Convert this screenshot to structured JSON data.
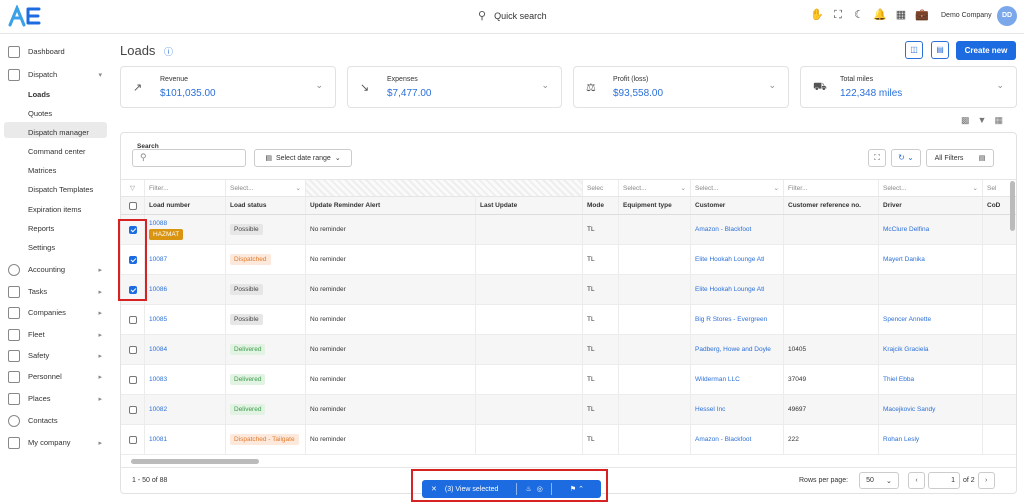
{
  "topbar": {
    "quick_search": "Quick search",
    "company": "Demo Company",
    "avatar": "DD"
  },
  "sidebar": {
    "dashboard": "Dashboard",
    "dispatch": "Dispatch",
    "dispatch_items": [
      "Loads",
      "Quotes",
      "Dispatch manager",
      "Command center",
      "Matrices",
      "Dispatch Templates",
      "Expiration items",
      "Reports",
      "Settings"
    ],
    "sections": [
      "Accounting",
      "Tasks",
      "Companies",
      "Fleet",
      "Safety",
      "Personnel",
      "Places",
      "Contacts",
      "My company"
    ]
  },
  "page": {
    "title": "Loads",
    "create_button": "Create new"
  },
  "cards": [
    {
      "label": "Revenue",
      "value": "$101,035.00"
    },
    {
      "label": "Expenses",
      "value": "$7,477.00"
    },
    {
      "label": "Profit (loss)",
      "value": "$93,558.00"
    },
    {
      "label": "Total miles",
      "value": "122,348 miles"
    }
  ],
  "toolbar": {
    "search_label": "Search",
    "date_range": "Select date range",
    "all_filters": "All Filters"
  },
  "filters": {
    "filter": "Filter...",
    "select": "Select...",
    "select_short": "Selec",
    "sel_short": "Sel"
  },
  "columns": [
    "Load number",
    "Load status",
    "Update Reminder Alert",
    "Last Update",
    "Mode",
    "Equipment type",
    "Customer",
    "Customer reference no.",
    "Driver",
    "CoD"
  ],
  "rows": [
    {
      "load": "10088",
      "tag": "HAZMAT",
      "status": "Possible",
      "reminder": "No reminder",
      "mode": "TL",
      "customer": "Amazon - Blackfoot",
      "ref": "",
      "driver": "McClure Delfina",
      "checked": true
    },
    {
      "load": "10087",
      "tag": "",
      "status": "Dispatched",
      "reminder": "No reminder",
      "mode": "TL",
      "customer": "Elite Hookah Lounge Atl",
      "ref": "",
      "driver": "Mayert Danika",
      "checked": true
    },
    {
      "load": "10086",
      "tag": "",
      "status": "Possible",
      "reminder": "No reminder",
      "mode": "TL",
      "customer": "Elite Hookah Lounge Atl",
      "ref": "",
      "driver": "",
      "checked": true
    },
    {
      "load": "10085",
      "tag": "",
      "status": "Possible",
      "reminder": "No reminder",
      "mode": "TL",
      "customer": "Big R Stores - Evergreen",
      "ref": "",
      "driver": "Spencer Annette",
      "checked": false
    },
    {
      "load": "10084",
      "tag": "",
      "status": "Delivered",
      "reminder": "No reminder",
      "mode": "TL",
      "customer": "Padberg, Howe and Doyle",
      "ref": "10405",
      "driver": "Krajcik Graciela",
      "checked": false
    },
    {
      "load": "10083",
      "tag": "",
      "status": "Delivered",
      "reminder": "No reminder",
      "mode": "TL",
      "customer": "Wilderman LLC",
      "ref": "37049",
      "driver": "Thiel Ebba",
      "checked": false
    },
    {
      "load": "10082",
      "tag": "",
      "status": "Delivered",
      "reminder": "No reminder",
      "mode": "TL",
      "customer": "Hessel Inc",
      "ref": "49697",
      "driver": "Macejkovic Sandy",
      "checked": false
    },
    {
      "load": "10081",
      "tag": "",
      "status": "Dispatched - Tailgate",
      "reminder": "No reminder",
      "mode": "TL",
      "customer": "Amazon - Blackfoot",
      "ref": "222",
      "driver": "Rohan Lesly",
      "checked": false
    }
  ],
  "footer": {
    "range": "1 - 50 of 88",
    "rows_per_page": "Rows per page:",
    "rpp_value": "50",
    "page": "1",
    "of_pages": "of 2"
  },
  "action_bar": {
    "view_selected": "(3) View selected"
  }
}
